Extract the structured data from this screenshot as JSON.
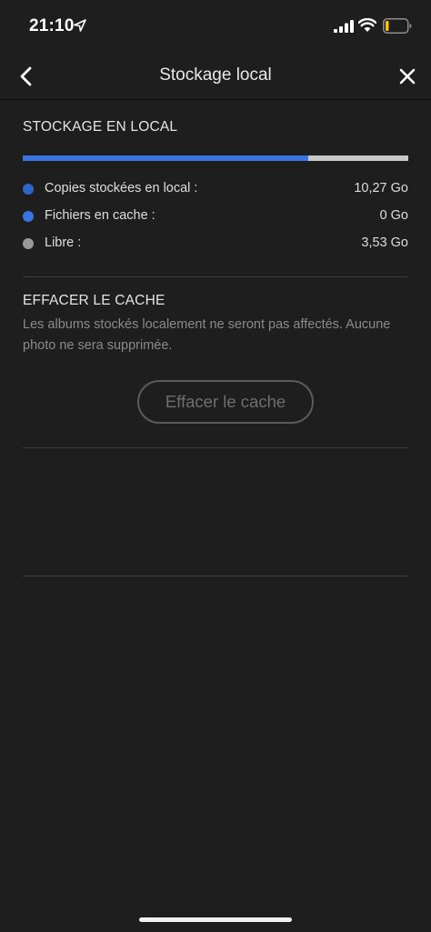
{
  "status_bar": {
    "time": "21:10",
    "icons": [
      "location-arrow-icon",
      "cellular-signal-icon",
      "wifi-icon",
      "battery-icon"
    ]
  },
  "nav": {
    "title": "Stockage local",
    "back_icon": "chevron-left-icon",
    "close_icon": "close-icon"
  },
  "storage": {
    "section_title": "STOCKAGE EN LOCAL",
    "used_fraction": 0.74,
    "colors": {
      "used": "#3a74e0",
      "free": "#c8c8c8"
    },
    "items": [
      {
        "label": "Copies stockées en local :",
        "value": "10,27 Go",
        "color": "#2f66c9"
      },
      {
        "label": "Fichiers en cache :",
        "value": "0 Go",
        "color": "#3a74e0"
      },
      {
        "label": "Libre :",
        "value": "3,53 Go",
        "color": "#9a9a9a"
      }
    ]
  },
  "cache": {
    "section_title": "EFFACER LE CACHE",
    "description": "Les albums stockés localement ne seront pas affectés. Aucune photo ne sera supprimée.",
    "button_label": "Effacer le cache"
  }
}
